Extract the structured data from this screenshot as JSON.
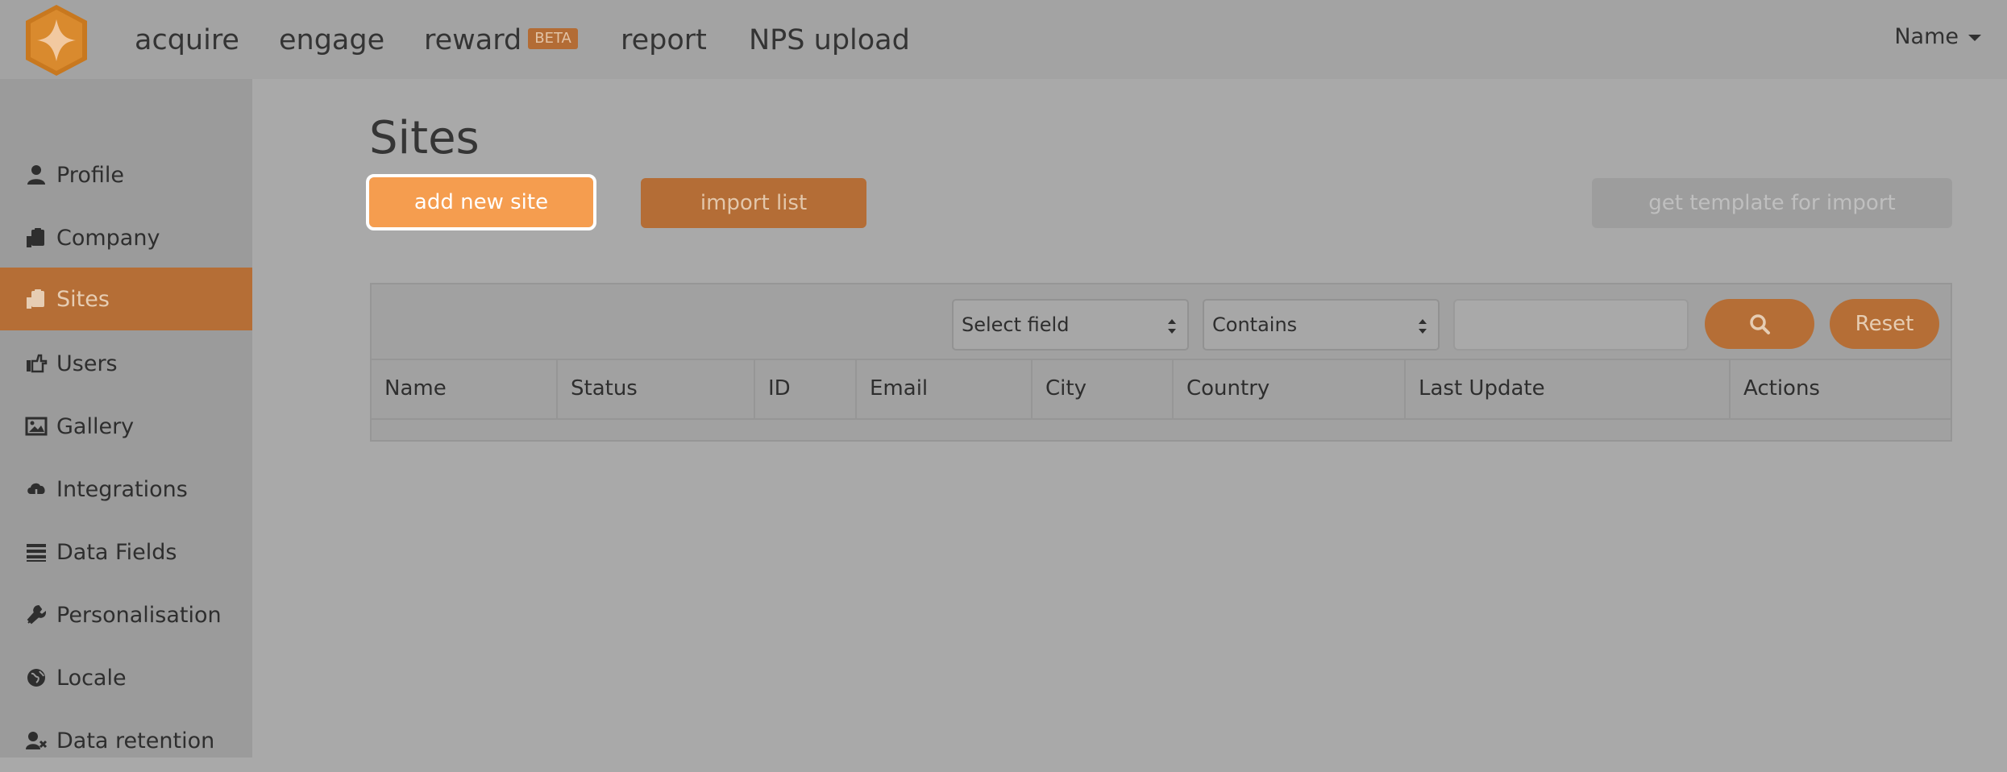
{
  "nav": {
    "items": [
      {
        "label": "acquire"
      },
      {
        "label": "engage"
      },
      {
        "label": "reward",
        "badge": "BETA"
      },
      {
        "label": "report"
      },
      {
        "label": "NPS upload"
      }
    ],
    "user_menu": "Name"
  },
  "sidebar": {
    "items": [
      {
        "label": "Profile",
        "icon": "user-icon"
      },
      {
        "label": "Company",
        "icon": "clipboard-icon"
      },
      {
        "label": "Sites",
        "icon": "clipboard-icon",
        "active": true
      },
      {
        "label": "Users",
        "icon": "hand-point-icon"
      },
      {
        "label": "Gallery",
        "icon": "image-icon"
      },
      {
        "label": "Integrations",
        "icon": "cloud-download-icon"
      },
      {
        "label": "Data Fields",
        "icon": "list-icon"
      },
      {
        "label": "Personalisation",
        "icon": "wrench-icon"
      },
      {
        "label": "Locale",
        "icon": "globe-icon"
      },
      {
        "label": "Data retention",
        "icon": "user-remove-icon"
      }
    ]
  },
  "main": {
    "title": "Sites",
    "add_button": "add new site",
    "import_button": "import list",
    "template_button": "get template for import",
    "filter": {
      "field_select": "Select field",
      "operator_select": "Contains",
      "search_value": "",
      "reset_label": "Reset"
    },
    "table": {
      "columns": [
        "Name",
        "Status",
        "ID",
        "Email",
        "City",
        "Country",
        "Last Update",
        "Actions"
      ]
    }
  },
  "colors": {
    "accent": "#f59d4f",
    "accent_dim": "#b56e36",
    "background": "#a9a9a9"
  }
}
